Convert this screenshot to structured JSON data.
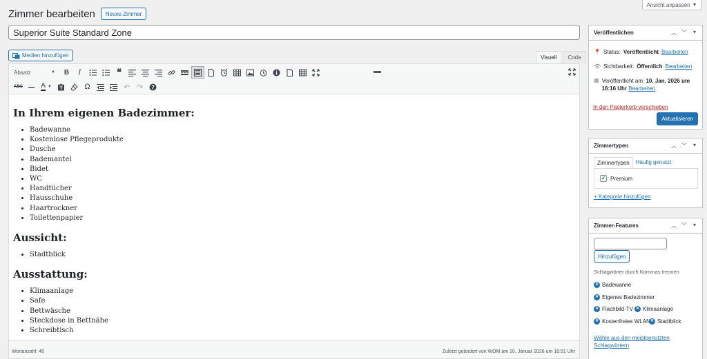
{
  "screen_options": {
    "label": "Ansicht anpassen"
  },
  "header": {
    "title": "Zimmer bearbeiten",
    "new_button": "Neues Zimmer"
  },
  "post": {
    "title_value": "Superior Suite Standard Zone"
  },
  "editor": {
    "media_button": "Medien hinzufügen",
    "tabs": {
      "visual": "Visuell",
      "code": "Code"
    },
    "format_select": "Absatz",
    "sections": [
      {
        "heading": "In Ihrem eigenen Badezimmer:",
        "items": [
          "Badewanne",
          "Kostenlose Pflegeprodukte",
          "Dusche",
          "Bademantel",
          "Bidet",
          "WC",
          "Handtücher",
          "Hausschuhe",
          "Haartrockner",
          "Toilettenpapier"
        ]
      },
      {
        "heading": "Aussicht:",
        "items": [
          "Stadtblick"
        ]
      },
      {
        "heading": "Ausstattung:",
        "items": [
          "Klimaanlage",
          "Safe",
          "Bettwäsche",
          "Steckdose in Bettnähe",
          "Schreibtisch"
        ]
      }
    ],
    "word_count": "Wortanzahl: 46",
    "last_modified": "Zuletzt geändert von WOM am 10. Januar 2026 um 16:51 Uhr"
  },
  "publish": {
    "title": "Veröffentlichen",
    "status_label": "Status:",
    "status_value": "Veröffentlicht",
    "edit": "Bearbeiten",
    "visibility_label": "Sichtbarkeit:",
    "visibility_value": "Öffentlich",
    "published_label": "Veröffentlicht am:",
    "published_value_1": "10. Jan. 2026 um",
    "published_value_2": "16:16 Uhr",
    "trash": "In den Papierkorb verschieben",
    "update": "Aktualisieren"
  },
  "room_types": {
    "title": "Zimmertypen",
    "tab_all": "Zimmertypen",
    "tab_popular": "Häufig genutzt",
    "checked_item": "Premium",
    "add_category": "+ Kategorie hinzufügen"
  },
  "features": {
    "title": "Zimmer-Features",
    "add_button": "Hinzufügen",
    "hint": "Schlagwörter durch Kommas trennen",
    "tags": [
      "Badewanne",
      "Eigenes Badezimmer",
      "Flachbild-TV",
      "Klimaanlage",
      "Kostenfreies WLAN",
      "Stadtblick"
    ],
    "choose_link": "Wähle aus den meistgenutzten Schlagwörtern"
  },
  "colors": {
    "accent": "#2271b1",
    "danger": "#b32d2e",
    "background": "#f0f0f1"
  }
}
